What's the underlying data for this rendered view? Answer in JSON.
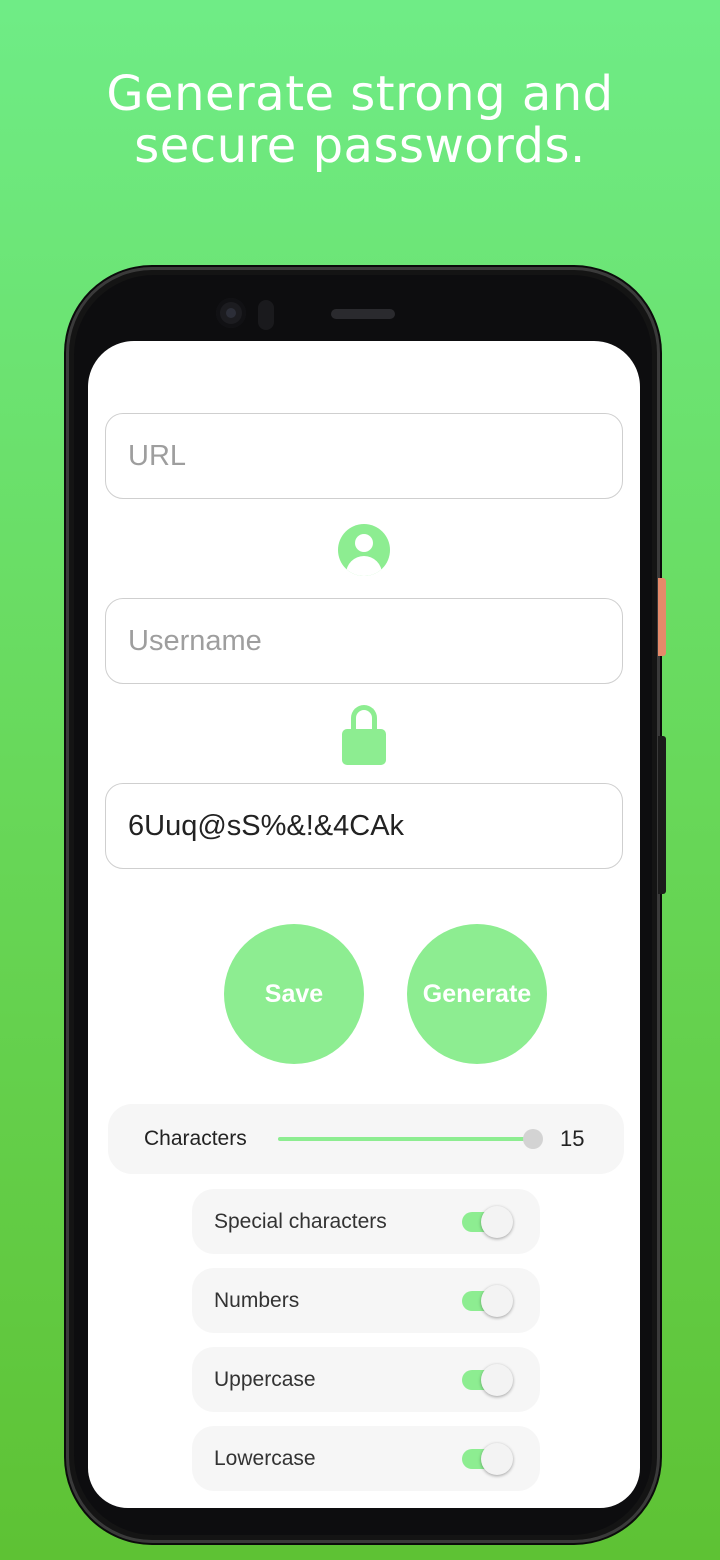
{
  "headline": {
    "line1": "Generate strong and",
    "line2": "secure passwords."
  },
  "form": {
    "url_placeholder": "URL",
    "username_placeholder": "Username",
    "password_value": "6Uuq@sS%&!&4CAk"
  },
  "icons": {
    "user": "account-circle-icon",
    "password": "lock-icon"
  },
  "actions": {
    "save_label": "Save",
    "generate_label": "Generate"
  },
  "length_setting": {
    "label": "Characters",
    "value": "15",
    "slider_position": 1.0
  },
  "options": [
    {
      "label": "Special characters",
      "enabled": true
    },
    {
      "label": "Numbers",
      "enabled": true
    },
    {
      "label": "Uppercase",
      "enabled": true
    },
    {
      "label": "Lowercase",
      "enabled": true
    }
  ],
  "colors": {
    "background_top": "#6fec86",
    "background_bottom": "#5ec234",
    "accent": "#8ded91",
    "field_border": "#cfcfcf",
    "card_bg": "#f6f6f6"
  }
}
